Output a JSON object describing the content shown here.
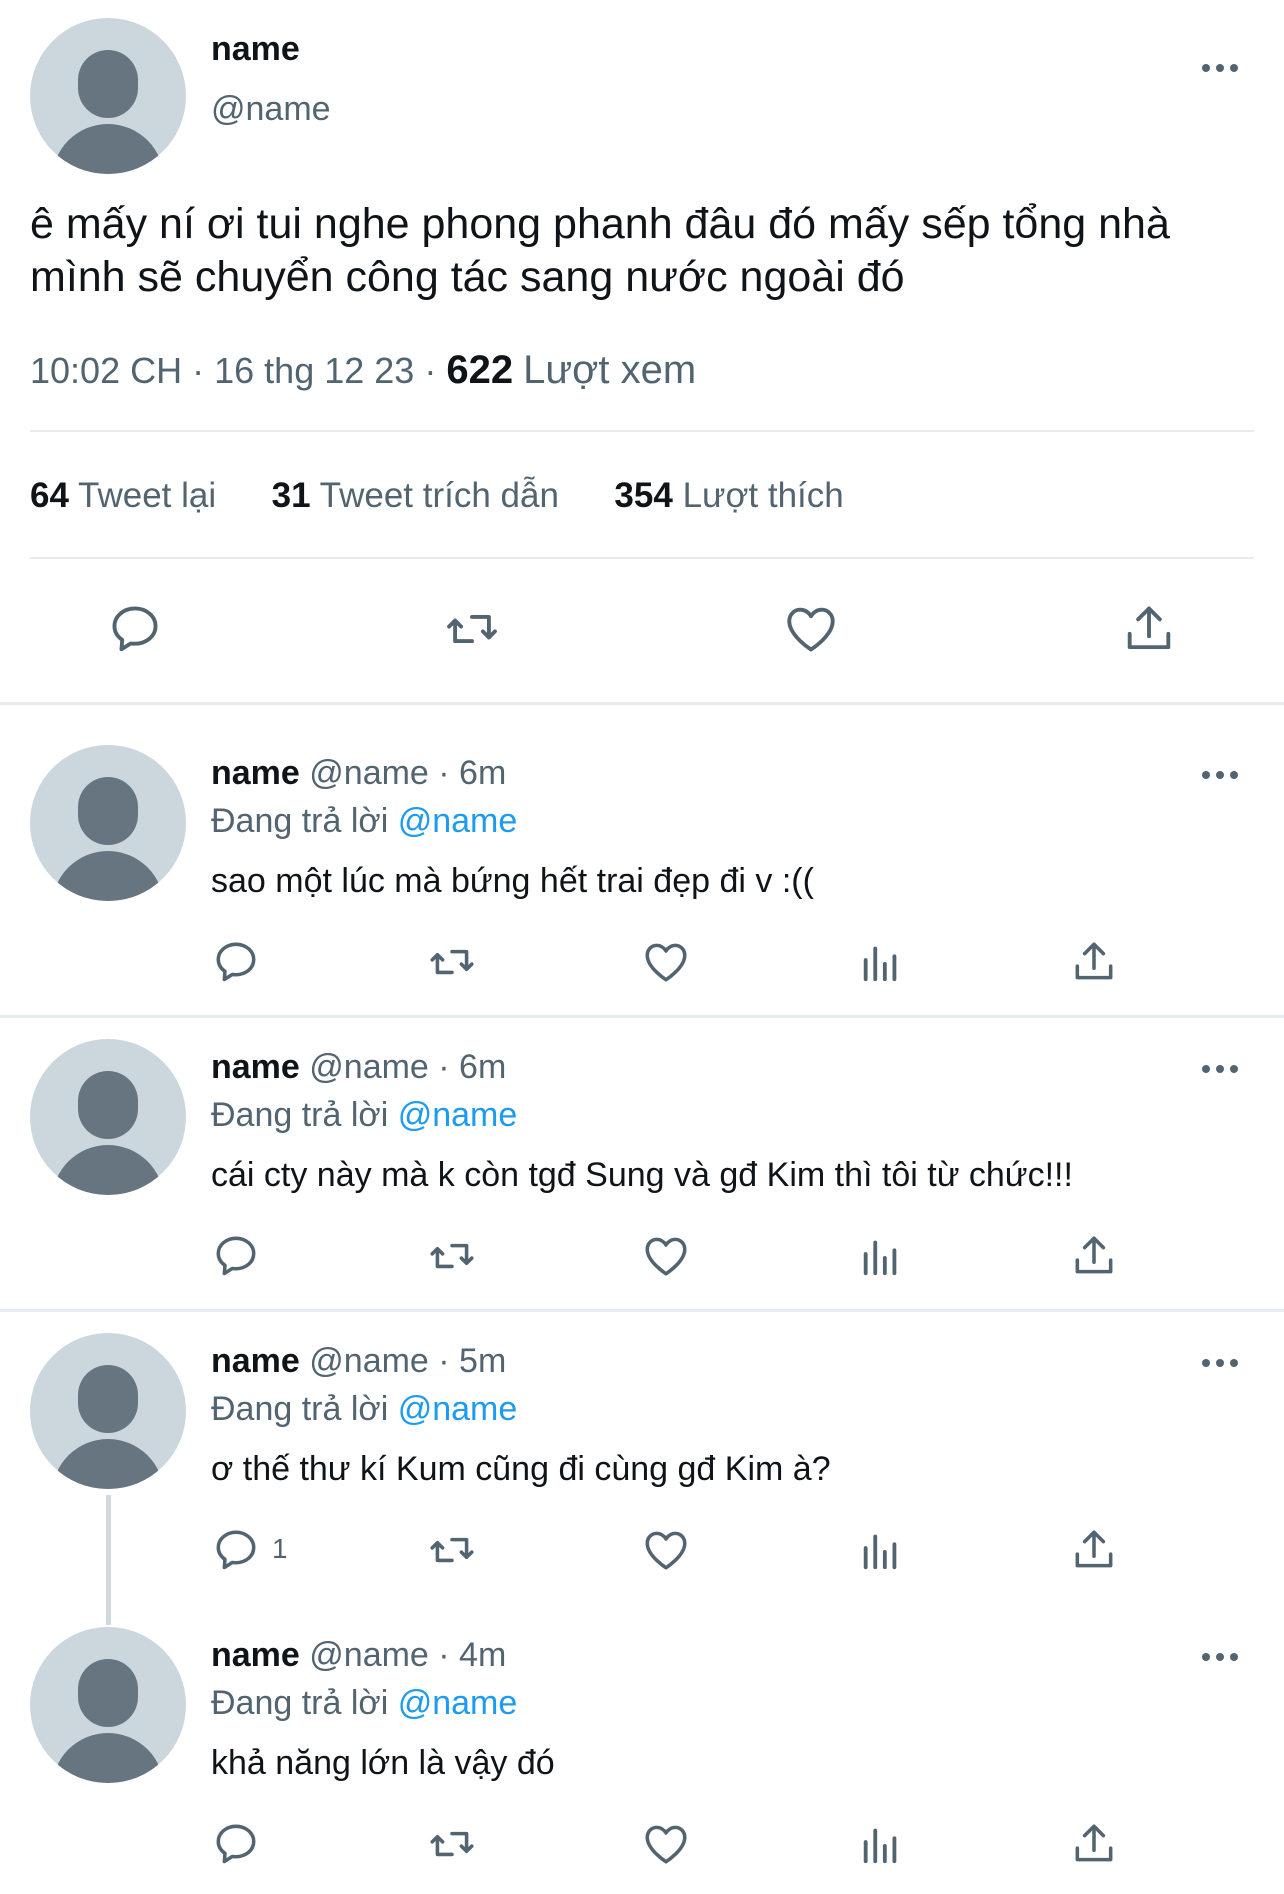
{
  "main_tweet": {
    "name": "name",
    "handle": "@name",
    "text_line1": "ê mấy ní ơi tui nghe phong phanh đâu đó mấy sếp tổng nhà",
    "text_line2": "mình sẽ chuyển công tác sang nước ngoài đó",
    "time": "10:02 CH",
    "date": "16 thg 12 23",
    "dot": "·",
    "views_count": "622",
    "views_label": "Lượt xem",
    "retweets_count": "64",
    "retweets_label": "Tweet lại",
    "quotes_count": "31",
    "quotes_label": "Tweet trích dẫn",
    "likes_count": "354",
    "likes_label": "Lượt thích"
  },
  "replies": [
    {
      "name": "name",
      "meta": "@name · 6m",
      "replying_label": "Đang trả lời",
      "replying_to": "@name",
      "text": "sao một lúc mà bứng hết trai đẹp đi v :((",
      "reply_count": ""
    },
    {
      "name": "name",
      "meta": "@name · 6m",
      "replying_label": "Đang trả lời",
      "replying_to": "@name",
      "text": "cái cty này mà k còn tgđ Sung và gđ Kim thì tôi từ chức!!!",
      "reply_count": ""
    },
    {
      "name": "name",
      "meta": "@name · 5m",
      "replying_label": "Đang trả lời",
      "replying_to": "@name",
      "text": "ơ thế thư kí Kum cũng đi cùng gđ Kim à?",
      "reply_count": "1"
    },
    {
      "name": "name",
      "meta": "@name · 4m",
      "replying_label": "Đang trả lời",
      "replying_to": "@name",
      "text": "khả năng lớn là vậy đó",
      "reply_count": ""
    }
  ],
  "colors": {
    "text": "#0f1419",
    "muted": "#536471",
    "link": "#1d9bf0",
    "avatar_bg": "#ccd6dd",
    "avatar_fg": "#66757f",
    "divider": "#e6ecf0"
  }
}
